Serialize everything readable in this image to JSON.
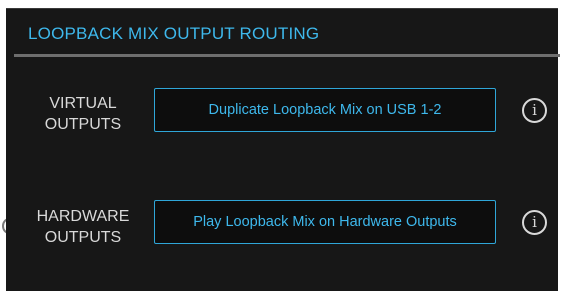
{
  "header": {
    "title": "LOOPBACK MIX OUTPUT ROUTING"
  },
  "rows": [
    {
      "label_line1": "VIRTUAL",
      "label_line2": "OUTPUTS",
      "button_label": "Duplicate Loopback Mix on USB 1-2",
      "info_glyph": "i"
    },
    {
      "label_line1": "HARDWARE",
      "label_line2": "OUTPUTS",
      "button_label": "Play Loopback Mix on Hardware Outputs",
      "info_glyph": "i"
    }
  ],
  "colors": {
    "accent": "#3eb8ec",
    "panel_background": "#171717",
    "label_text": "#d9d9d9",
    "divider": "#6e6e6e"
  },
  "icons": {
    "info": "info-circle-icon"
  }
}
